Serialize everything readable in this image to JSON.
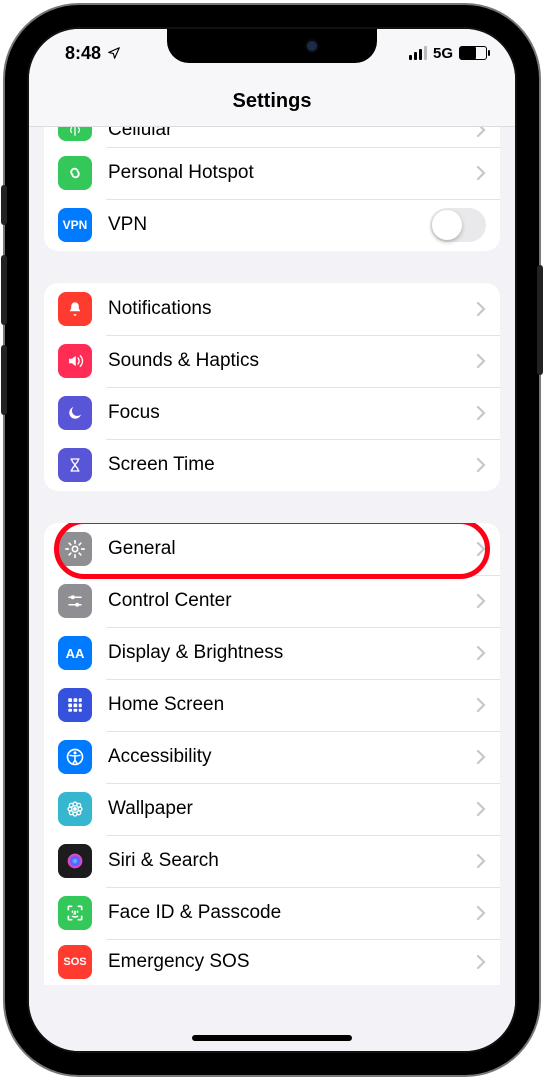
{
  "status": {
    "time": "8:48",
    "network_label": "5G"
  },
  "nav": {
    "title": "Settings"
  },
  "groups": [
    {
      "id": "connectivity",
      "partial_top": true,
      "rows": [
        {
          "id": "cellular",
          "label": "Cellular",
          "icon": "antenna",
          "icon_bg": "#34c759",
          "accessory": "chevron",
          "clipped": true
        },
        {
          "id": "hotspot",
          "label": "Personal Hotspot",
          "icon": "link",
          "icon_bg": "#34c759",
          "accessory": "chevron"
        },
        {
          "id": "vpn",
          "label": "VPN",
          "icon": "vpn-text",
          "icon_bg": "#007aff",
          "accessory": "toggle",
          "toggle_on": false
        }
      ]
    },
    {
      "id": "notifications-group",
      "rows": [
        {
          "id": "notifications",
          "label": "Notifications",
          "icon": "bell",
          "icon_bg": "#ff3b30",
          "accessory": "chevron"
        },
        {
          "id": "sounds",
          "label": "Sounds & Haptics",
          "icon": "speaker",
          "icon_bg": "#ff2d55",
          "accessory": "chevron"
        },
        {
          "id": "focus",
          "label": "Focus",
          "icon": "moon",
          "icon_bg": "#5856d6",
          "accessory": "chevron"
        },
        {
          "id": "screentime",
          "label": "Screen Time",
          "icon": "hourglass",
          "icon_bg": "#5856d6",
          "accessory": "chevron"
        }
      ]
    },
    {
      "id": "general-group",
      "partial_bottom": true,
      "rows": [
        {
          "id": "general",
          "label": "General",
          "icon": "gear",
          "icon_bg": "#8e8e93",
          "accessory": "chevron",
          "highlighted": true
        },
        {
          "id": "controlcenter",
          "label": "Control Center",
          "icon": "sliders",
          "icon_bg": "#8e8e93",
          "accessory": "chevron"
        },
        {
          "id": "display",
          "label": "Display & Brightness",
          "icon": "aa-text",
          "icon_bg": "#007aff",
          "accessory": "chevron"
        },
        {
          "id": "homescreen",
          "label": "Home Screen",
          "icon": "grid",
          "icon_bg": "#3651db",
          "accessory": "chevron"
        },
        {
          "id": "accessibility",
          "label": "Accessibility",
          "icon": "person-circle",
          "icon_bg": "#007aff",
          "accessory": "chevron"
        },
        {
          "id": "wallpaper",
          "label": "Wallpaper",
          "icon": "flower",
          "icon_bg": "#36b7cf",
          "accessory": "chevron"
        },
        {
          "id": "siri",
          "label": "Siri & Search",
          "icon": "siri-orb",
          "icon_bg": "#1c1c1e",
          "accessory": "chevron"
        },
        {
          "id": "faceid",
          "label": "Face ID & Passcode",
          "icon": "face",
          "icon_bg": "#34c759",
          "accessory": "chevron"
        },
        {
          "id": "sos",
          "label": "Emergency SOS",
          "icon": "sos-text",
          "icon_bg": "#ff3b30",
          "accessory": "chevron",
          "clipped_bottom": true
        }
      ]
    }
  ],
  "icon_text": {
    "vpn": "VPN",
    "aa": "AA",
    "sos": "SOS"
  }
}
